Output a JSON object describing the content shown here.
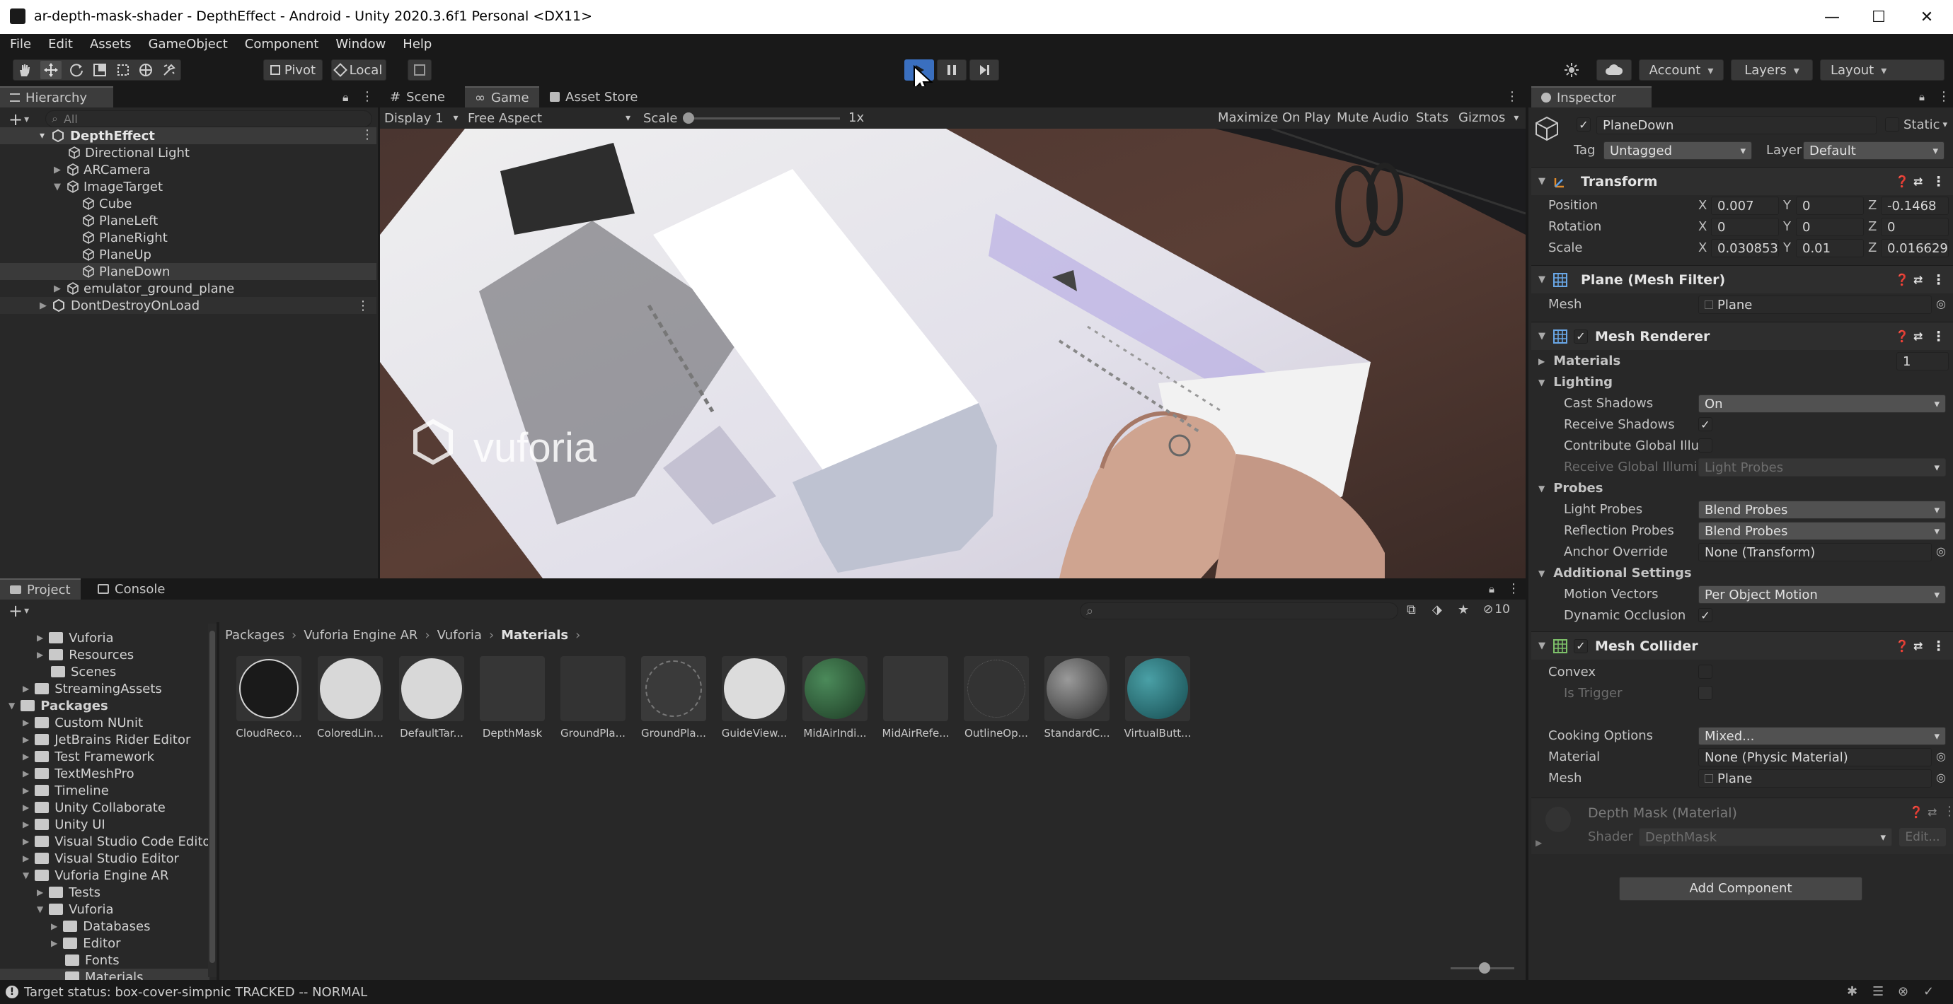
{
  "window": {
    "title": "ar-depth-mask-shader - DepthEffect - Android - Unity 2020.3.6f1 Personal <DX11>",
    "minimize": "—",
    "maximize": "☐",
    "close": "✕"
  },
  "menu": [
    "File",
    "Edit",
    "Assets",
    "GameObject",
    "Component",
    "Window",
    "Help"
  ],
  "toolbar": {
    "pivot": "Pivot",
    "local": "Local",
    "account": "Account",
    "layers": "Layers",
    "layout": "Layout"
  },
  "hierarchy": {
    "tab": "Hierarchy",
    "search_placeholder": "All",
    "scene": "DepthEffect",
    "items": [
      {
        "label": "Directional Light"
      },
      {
        "label": "ARCamera"
      },
      {
        "label": "ImageTarget"
      },
      {
        "label": "Cube"
      },
      {
        "label": "PlaneLeft"
      },
      {
        "label": "PlaneRight"
      },
      {
        "label": "PlaneUp"
      },
      {
        "label": "PlaneDown"
      },
      {
        "label": "emulator_ground_plane"
      },
      {
        "label": "DontDestroyOnLoad"
      }
    ]
  },
  "viewtabs": {
    "scene": "Scene",
    "game": "Game",
    "store": "Asset Store",
    "display": "Display 1",
    "aspect": "Free Aspect",
    "scale_label": "Scale",
    "scale_value": "1x",
    "maximize": "Maximize On Play",
    "mute": "Mute Audio",
    "stats": "Stats",
    "gizmos": "Gizmos",
    "watermark": "vuforia"
  },
  "project": {
    "tab_project": "Project",
    "tab_console": "Console",
    "hidden_count": "10",
    "breadcrumb": [
      "Packages",
      "Vuforia Engine AR",
      "Vuforia",
      "Materials"
    ],
    "tree": [
      {
        "label": "Vuforia"
      },
      {
        "label": "Resources"
      },
      {
        "label": "Scenes"
      },
      {
        "label": "StreamingAssets"
      },
      {
        "label": "Packages"
      },
      {
        "label": "Custom NUnit"
      },
      {
        "label": "JetBrains Rider Editor"
      },
      {
        "label": "Test Framework"
      },
      {
        "label": "TextMeshPro"
      },
      {
        "label": "Timeline"
      },
      {
        "label": "Unity Collaborate"
      },
      {
        "label": "Unity UI"
      },
      {
        "label": "Visual Studio Code Editor"
      },
      {
        "label": "Visual Studio Editor"
      },
      {
        "label": "Vuforia Engine AR"
      },
      {
        "label": "Tests"
      },
      {
        "label": "Vuforia"
      },
      {
        "label": "Databases"
      },
      {
        "label": "Editor"
      },
      {
        "label": "Fonts"
      },
      {
        "label": "Materials"
      }
    ],
    "assets": [
      {
        "label": "CloudReco...",
        "color": "#1a1a1a"
      },
      {
        "label": "ColoredLin...",
        "color": "#d8d8d8"
      },
      {
        "label": "DefaultTar...",
        "color": "#d8d8d8"
      },
      {
        "label": "DepthMask",
        "color": "#363636"
      },
      {
        "label": "GroundPla...",
        "color": "#333333"
      },
      {
        "label": "GroundPla...",
        "color": "#3a3a3a"
      },
      {
        "label": "GuideView...",
        "color": "#dcdcdc"
      },
      {
        "label": "MidAirIndi...",
        "color": "#2b5a36"
      },
      {
        "label": "MidAirRefe...",
        "color": "#363636"
      },
      {
        "label": "OutlineOp...",
        "color": "#333333"
      },
      {
        "label": "StandardC...",
        "color": "#6a6a6a"
      },
      {
        "label": "VirtualButt...",
        "color": "#2d6e72"
      }
    ]
  },
  "status": {
    "text": "Target status: box-cover-simpnic TRACKED -- NORMAL"
  },
  "inspector": {
    "tab": "Inspector",
    "object_name": "PlaneDown",
    "static_label": "Static",
    "tag_label": "Tag",
    "tag_value": "Untagged",
    "layer_label": "Layer",
    "layer_value": "Default",
    "transform": {
      "title": "Transform",
      "position_label": "Position",
      "rotation_label": "Rotation",
      "scale_label": "Scale",
      "position": {
        "x": "0.007",
        "y": "0",
        "z": "-0.1468"
      },
      "rotation": {
        "x": "0",
        "y": "0",
        "z": "0"
      },
      "scale": {
        "x": "0.030853",
        "y": "0.01",
        "z": "0.016629"
      }
    },
    "meshfilter": {
      "title": "Plane (Mesh Filter)",
      "mesh_label": "Mesh",
      "mesh_value": "Plane"
    },
    "renderer": {
      "title": "Mesh Renderer",
      "materials_label": "Materials",
      "materials_count": "1",
      "lighting_label": "Lighting",
      "cast_label": "Cast Shadows",
      "cast_value": "On",
      "receive_label": "Receive Shadows",
      "contribute_label": "Contribute Global Illum",
      "receive_gi_label": "Receive Global Illumin",
      "receive_gi_value": "Light Probes",
      "probes_label": "Probes",
      "light_probes_label": "Light Probes",
      "light_probes_value": "Blend Probes",
      "reflection_label": "Reflection Probes",
      "reflection_value": "Blend Probes",
      "anchor_label": "Anchor Override",
      "anchor_value": "None (Transform)",
      "additional_label": "Additional Settings",
      "motion_label": "Motion Vectors",
      "motion_value": "Per Object Motion",
      "dynamic_label": "Dynamic Occlusion"
    },
    "collider": {
      "title": "Mesh Collider",
      "convex_label": "Convex",
      "trigger_label": "Is Trigger",
      "cooking_label": "Cooking Options",
      "cooking_value": "Mixed...",
      "material_label": "Material",
      "material_value": "None (Physic Material)",
      "mesh_label": "Mesh",
      "mesh_value": "Plane"
    },
    "material": {
      "title": "Depth Mask (Material)",
      "shader_label": "Shader",
      "shader_value": "DepthMask",
      "edit": "Edit..."
    },
    "add_component": "Add Component"
  }
}
